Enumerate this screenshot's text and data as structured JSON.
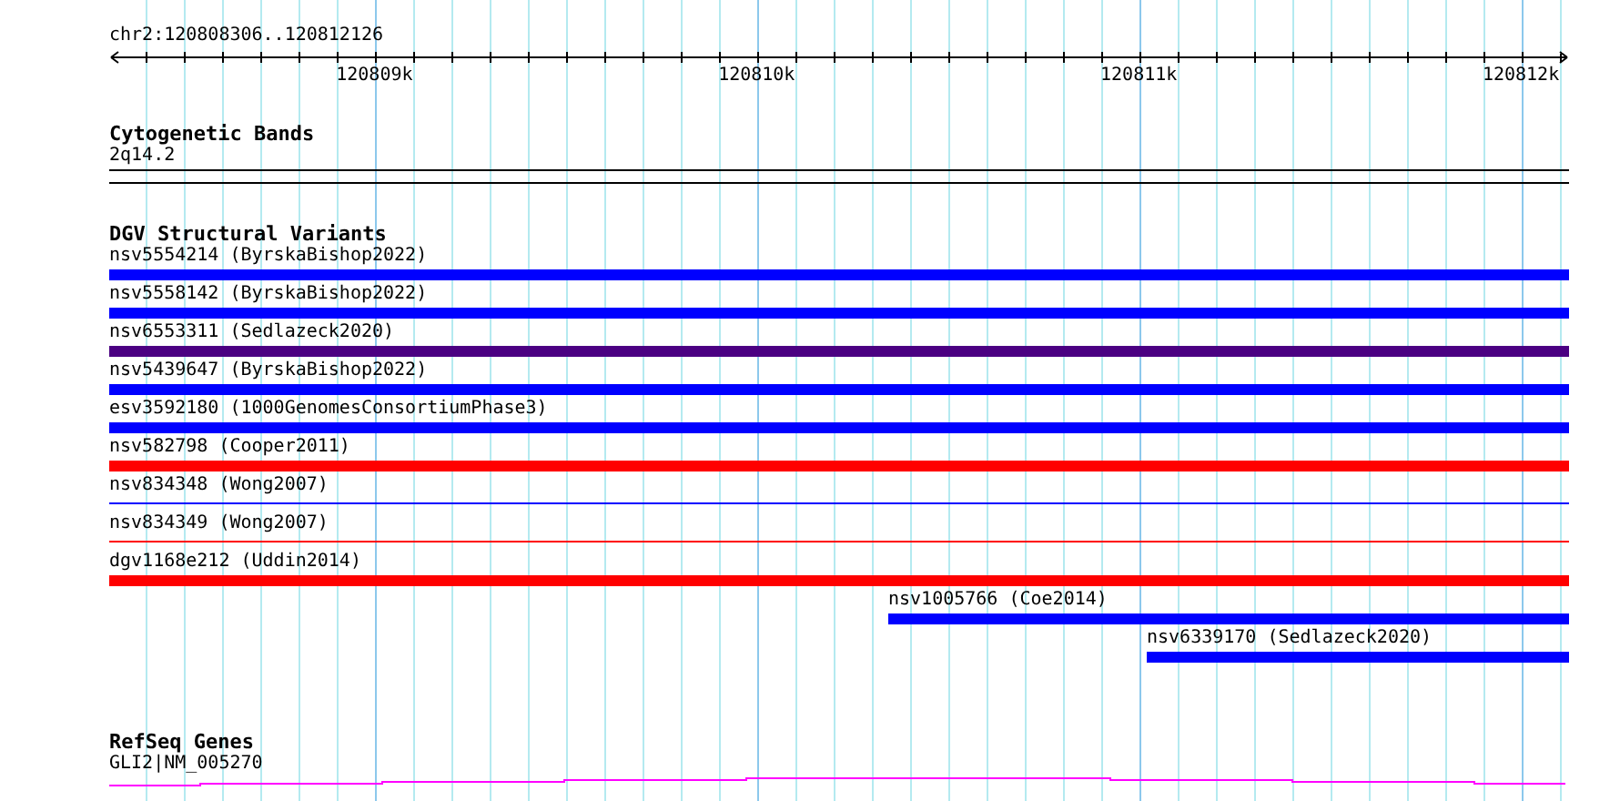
{
  "ruler": {
    "location": "chr2:120808306..120812126",
    "ticks": [
      "120809k",
      "120810k",
      "120811k",
      "120812k"
    ]
  },
  "tracks": [
    {
      "title": "Cytogenetic Bands",
      "kind": "bands",
      "features": [
        {
          "label": "2q14.2"
        }
      ]
    },
    {
      "title": "DGV Structural Variants",
      "kind": "variants",
      "features": [
        {
          "label": "nsv5554214 (ByrskaBishop2022)",
          "kind": "thick",
          "color": "#0000ff"
        },
        {
          "label": "nsv5558142 (ByrskaBishop2022)",
          "kind": "thick",
          "color": "#0000ff"
        },
        {
          "label": "nsv6553311 (Sedlazeck2020)",
          "kind": "thick",
          "color": "#4b0082"
        },
        {
          "label": "nsv5439647 (ByrskaBishop2022)",
          "kind": "thick",
          "color": "#0000ff"
        },
        {
          "label": "esv3592180 (1000GenomesConsortiumPhase3)",
          "kind": "thick",
          "color": "#0000ff"
        },
        {
          "label": "nsv582798 (Cooper2011)",
          "kind": "thick",
          "color": "#ff0000"
        },
        {
          "label": "nsv834348 (Wong2007)",
          "kind": "thin",
          "color": "#0000ff"
        },
        {
          "label": "nsv834349 (Wong2007)",
          "kind": "thin",
          "color": "#ff0000"
        },
        {
          "label": "dgv1168e212 (Uddin2014)",
          "kind": "thick",
          "color": "#ff0000"
        },
        {
          "label": "nsv1005766 (Coe2014)",
          "kind": "thick",
          "color": "#0000ff"
        },
        {
          "label": "nsv6339170 (Sedlazeck2020)",
          "kind": "thick",
          "color": "#0000ff"
        }
      ]
    },
    {
      "title": "RefSeq Genes",
      "kind": "genes",
      "features": [
        {
          "label": "GLI2|NM_005270",
          "color": "#ff00ff"
        }
      ]
    }
  ]
}
